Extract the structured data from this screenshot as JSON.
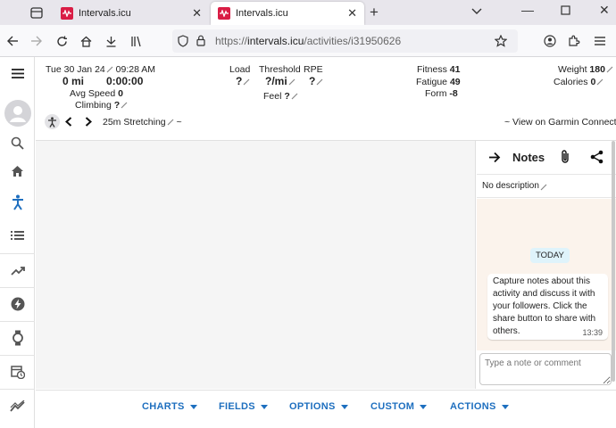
{
  "browser": {
    "tabs": [
      {
        "title": "Intervals.icu",
        "active": false
      },
      {
        "title": "Intervals.icu",
        "active": true
      }
    ],
    "url_prefix": "https://",
    "url_host": "intervals.icu",
    "url_path": "/activities/i31950626"
  },
  "header": {
    "date": "Tue 30 Jan 24",
    "time": "09:28 AM",
    "distance": "0 mi",
    "duration": "0:00:00",
    "avg_speed_label": "Avg Speed",
    "avg_speed_value": "0",
    "climbing_label": "Climbing",
    "climbing_value": "?",
    "load_label": "Load",
    "load_value": "?",
    "threshold_label": "Threshold",
    "threshold_value": "?/mi",
    "rpe_label": "RPE",
    "rpe_value": "?",
    "feel_label": "Feel",
    "feel_value": "?",
    "fitness_label": "Fitness",
    "fitness_value": "41",
    "fatigue_label": "Fatigue",
    "fatigue_value": "49",
    "form_label": "Form",
    "form_value": "-8",
    "weight_label": "Weight",
    "weight_value": "180",
    "calories_label": "Calories",
    "calories_value": "0",
    "activity_name": "25m Stretching",
    "activity_suffix": "~",
    "garmin_link": "~ View on Garmin Connect"
  },
  "notes": {
    "title": "Notes",
    "description": "No description",
    "today_label": "TODAY",
    "message": "Capture notes about this activity and discuss it with your followers. Click the share button to share with others.",
    "message_time": "13:39",
    "input_placeholder": "Type a note or comment"
  },
  "toolbar": {
    "charts": "CHARTS",
    "fields": "FIELDS",
    "options": "OPTIONS",
    "custom": "CUSTOM",
    "actions": "ACTIONS"
  },
  "colors": {
    "accent": "#1e6fbf",
    "brand": "#d91d45",
    "notes_bg": "#fbf3ec",
    "today_bg": "#dff3fb"
  }
}
